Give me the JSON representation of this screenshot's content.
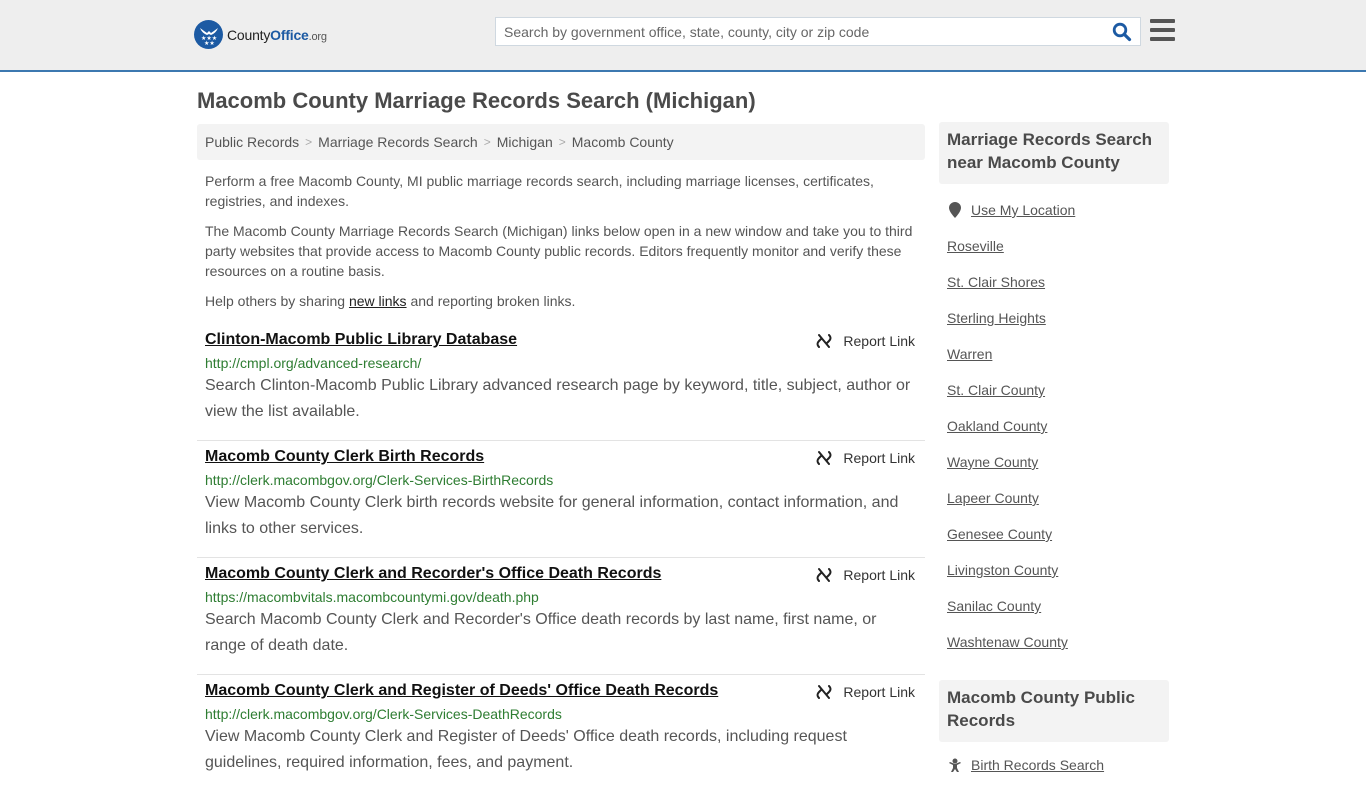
{
  "header": {
    "logo": {
      "name": "County",
      "name_bold": "Office",
      "tld": ".org"
    },
    "search": {
      "placeholder": "Search by government office, state, county, city or zip code",
      "value": ""
    },
    "colors": {
      "brand_blue": "#1c5aa3",
      "header_bg": "#eeeeee",
      "accent_line": "#3c78b0"
    }
  },
  "page": {
    "title": "Macomb County Marriage Records Search (Michigan)",
    "breadcrumb": [
      {
        "label": "Public Records"
      },
      {
        "label": "Marriage Records Search"
      },
      {
        "label": "Michigan"
      },
      {
        "label": "Macomb County"
      }
    ],
    "intro": {
      "p1": "Perform a free Macomb County, MI public marriage records search, including marriage licenses, certificates, registries, and indexes.",
      "p2": "The Macomb County Marriage Records Search (Michigan) links below open in a new window and take you to third party websites that provide access to Macomb County public records. Editors frequently monitor and verify these resources on a routine basis.",
      "p3_before": "Help others by sharing ",
      "p3_link": "new links",
      "p3_after": " and reporting broken links."
    },
    "report_label": "Report Link",
    "results": [
      {
        "title": "Clinton-Macomb Public Library Database",
        "url": "http://cmpl.org/advanced-research/",
        "description": "Search Clinton-Macomb Public Library advanced research page by keyword, title, subject, author or view the list available."
      },
      {
        "title": "Macomb County Clerk Birth Records",
        "url": "http://clerk.macombgov.org/Clerk-Services-BirthRecords",
        "description": "View Macomb County Clerk birth records website for general information, contact information, and links to other services."
      },
      {
        "title": "Macomb County Clerk and Recorder's Office Death Records",
        "url": "https://macombvitals.macombcountymi.gov/death.php",
        "description": "Search Macomb County Clerk and Recorder's Office death records by last name, first name, or range of death date."
      },
      {
        "title": "Macomb County Clerk and Register of Deeds' Office Death Records",
        "url": "http://clerk.macombgov.org/Clerk-Services-DeathRecords",
        "description": "View Macomb County Clerk and Register of Deeds' Office death records, including request guidelines, required information, fees, and payment."
      }
    ]
  },
  "sidebar": {
    "nearby_heading": "Marriage Records Search near Macomb County",
    "use_location": "Use My Location",
    "nearby": [
      "Roseville",
      "St. Clair Shores",
      "Sterling Heights",
      "Warren",
      "St. Clair County",
      "Oakland County",
      "Wayne County",
      "Lapeer County",
      "Genesee County",
      "Livingston County",
      "Sanilac County",
      "Washtenaw County"
    ],
    "public_records_heading": "Macomb County Public Records",
    "public_records": [
      {
        "label": "Birth Records Search",
        "icon": "baby-icon"
      }
    ]
  }
}
